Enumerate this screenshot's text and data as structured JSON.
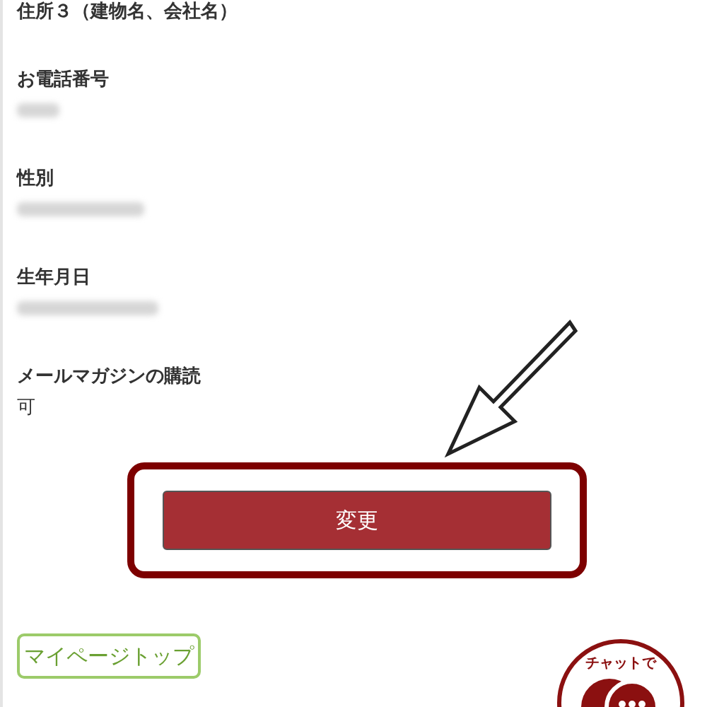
{
  "fields": [
    {
      "label": "住所３（建物名、会社名）",
      "redacted": false
    },
    {
      "label": "お電話番号",
      "redacted": true
    },
    {
      "label": "性別",
      "redacted": true
    },
    {
      "label": "生年月日",
      "redacted": true
    },
    {
      "label": "メールマガジンの購読",
      "value": "可",
      "redacted": false
    }
  ],
  "submit": {
    "label": "変更",
    "highlighted": true
  },
  "mypage_link": {
    "label": "マイページトップ"
  },
  "chat_badge": {
    "label": "チャットで"
  }
}
